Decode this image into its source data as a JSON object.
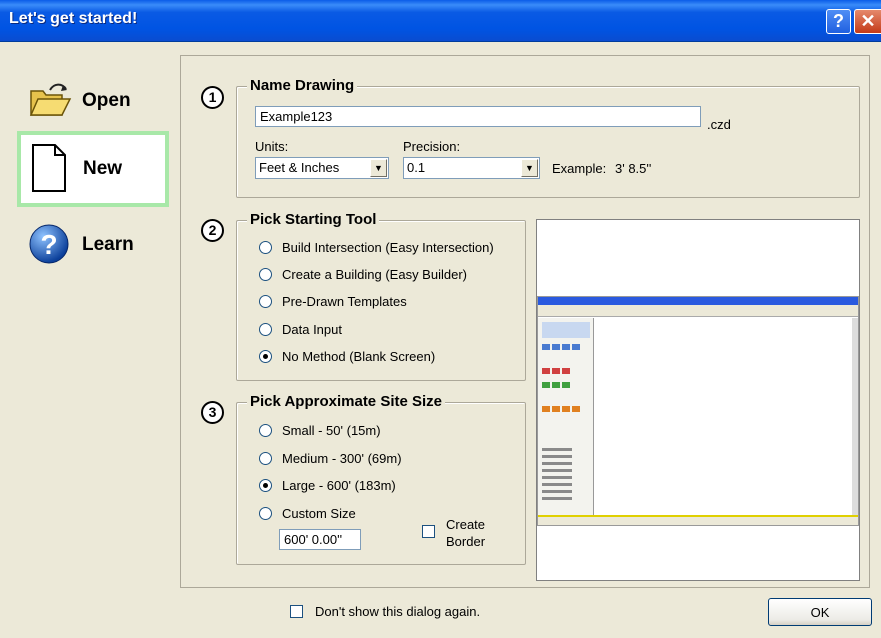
{
  "window": {
    "title": "Let's get started!"
  },
  "nav": {
    "open_label": "Open",
    "new_label": "New",
    "learn_label": "Learn"
  },
  "name_drawing": {
    "number": "1",
    "title": "Name Drawing",
    "name_value": "Example123",
    "extension": ".czd",
    "units_label": "Units:",
    "units_value": "Feet & Inches",
    "precision_label": "Precision:",
    "precision_value": "0.1",
    "example_label": "Example:",
    "example_value": "3' 8.5''"
  },
  "starting_tool": {
    "number": "2",
    "title": "Pick Starting Tool",
    "options": [
      {
        "label": "Build Intersection (Easy Intersection)",
        "selected": false
      },
      {
        "label": "Create a Building (Easy Builder)",
        "selected": false
      },
      {
        "label": "Pre-Drawn Templates",
        "selected": false
      },
      {
        "label": "Data Input",
        "selected": false
      },
      {
        "label": "No Method (Blank Screen)",
        "selected": true
      }
    ]
  },
  "site_size": {
    "number": "3",
    "title": "Pick Approximate Site Size",
    "options": [
      {
        "label": "Small - 50' (15m)",
        "selected": false
      },
      {
        "label": "Medium - 300' (69m)",
        "selected": false
      },
      {
        "label": "Large - 600' (183m)",
        "selected": true
      },
      {
        "label": "Custom Size",
        "selected": false
      }
    ],
    "custom_value": "600' 0.00''",
    "create_border_line1": "Create",
    "create_border_line2": "Border",
    "create_border_checked": false
  },
  "footer": {
    "dont_show_label": "Don't show this dialog again.",
    "dont_show_checked": false,
    "ok_label": "OK"
  },
  "colors": {
    "titlebar": "#0054e3",
    "dialog_bg": "#ece9d8",
    "new_highlight": "#a8e8a8"
  },
  "icons": {
    "open": "open-folder-icon",
    "new": "blank-document-icon",
    "learn": "help-globe-icon"
  }
}
